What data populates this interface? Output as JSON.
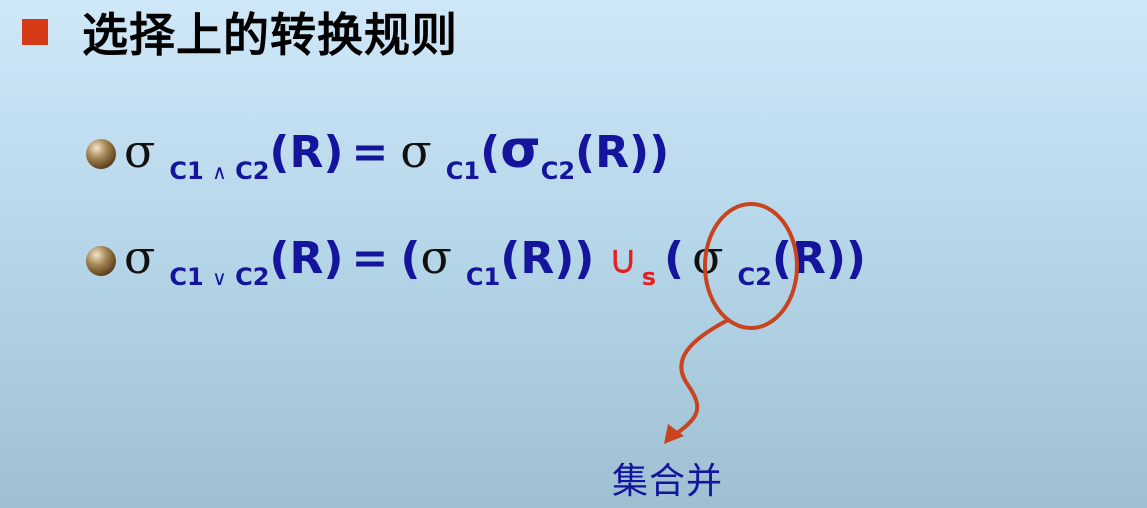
{
  "title": "选择上的转换规则",
  "rule1": {
    "sigma": "σ",
    "sub_c1": "C1",
    "and_op": "∧",
    "sub_c2": "C2",
    "lhs_arg": "(R)",
    "equals": "=",
    "rhs_sigma": "σ",
    "rhs_sub_c1": "C1",
    "rhs_open": "(",
    "rhs_inner_sigma": "σ",
    "rhs_inner_sub": "C2",
    "rhs_tail": "(R))"
  },
  "rule2": {
    "sigma": "σ",
    "sub_c1": "C1",
    "or_op": "∨",
    "sub_c2": "C2",
    "lhs_arg": "(R)",
    "equals": "=",
    "open_left": "(",
    "left_sigma": "σ",
    "left_sub": "C1",
    "left_tail": "(R))",
    "union": "∪",
    "union_sub": "s",
    "open_right": "(",
    "right_sigma": "σ",
    "right_sub": "C2",
    "right_tail": "(R))"
  },
  "annotation": {
    "caption": "集合并",
    "circle_color": "#c8431e",
    "arrow_color": "#c8431e"
  },
  "colors": {
    "title_bullet": "#d63a17",
    "formula": "#14149c",
    "union": "#e62020",
    "background_top": "#cfe8f8",
    "background_bottom": "#9fbfd2"
  }
}
